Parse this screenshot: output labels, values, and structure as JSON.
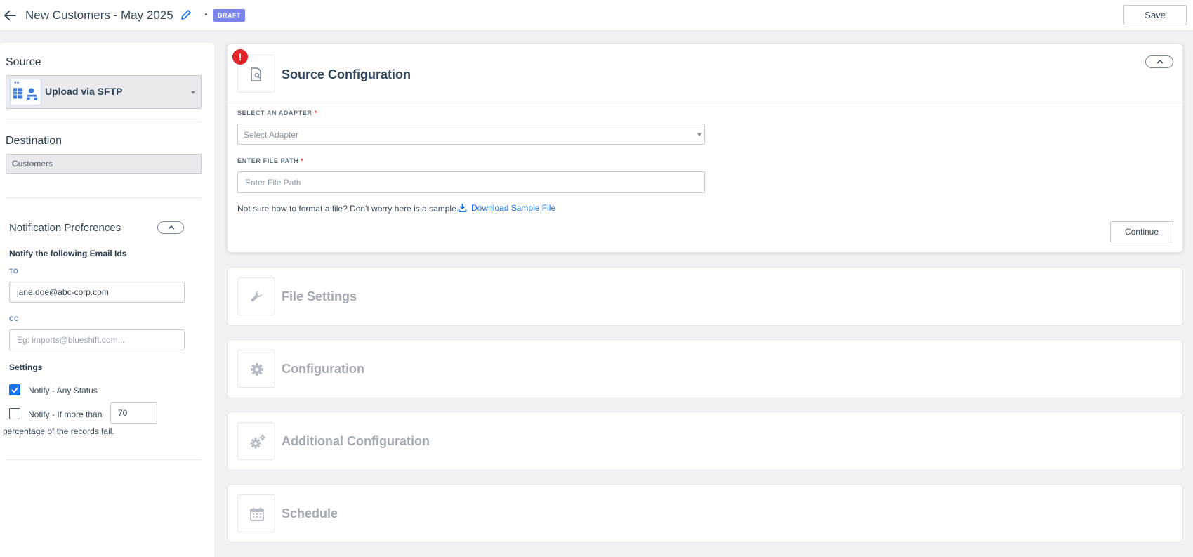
{
  "header": {
    "title": "New Customers - May 2025",
    "status_badge": "DRAFT",
    "save_label": "Save"
  },
  "sidebar": {
    "source_heading": "Source",
    "source_value": "Upload via SFTP",
    "destination_heading": "Destination",
    "destination_value": "Customers",
    "notification": {
      "title": "Notification Preferences",
      "notify_heading": "Notify the following Email Ids",
      "to_label": "TO",
      "to_value": "jane.doe@abc-corp.com",
      "cc_label": "CC",
      "cc_placeholder": "Eg: imports@blueshift.com...",
      "settings_heading": "Settings",
      "any_status_label": "Notify - Any Status",
      "any_status_checked": true,
      "more_than_label": "Notify - If more than",
      "more_than_checked": false,
      "percent_value": "70",
      "percent_suffix": "percentage of the records fail."
    }
  },
  "source_config": {
    "title": "Source Configuration",
    "adapter_label": "SELECT AN ADAPTER",
    "adapter_placeholder": "Select Adapter",
    "filepath_label": "ENTER FILE PATH",
    "filepath_placeholder": "Enter File Path",
    "required_mark": "*",
    "sample_text": "Not sure how to format a file? Don't worry here is a sample.",
    "download_label": "Download Sample File",
    "continue_label": "Continue",
    "error_mark": "!"
  },
  "steps": [
    {
      "title": "File Settings",
      "icon": "wrench-icon"
    },
    {
      "title": "Configuration",
      "icon": "gear-icon"
    },
    {
      "title": "Additional Configuration",
      "icon": "gears-icon"
    },
    {
      "title": "Schedule",
      "icon": "calendar-icon"
    }
  ],
  "colors": {
    "accent": "#1a73e8",
    "draft_badge": "#7b83f0",
    "error": "#e0242b",
    "muted_title": "#a3aab3"
  }
}
